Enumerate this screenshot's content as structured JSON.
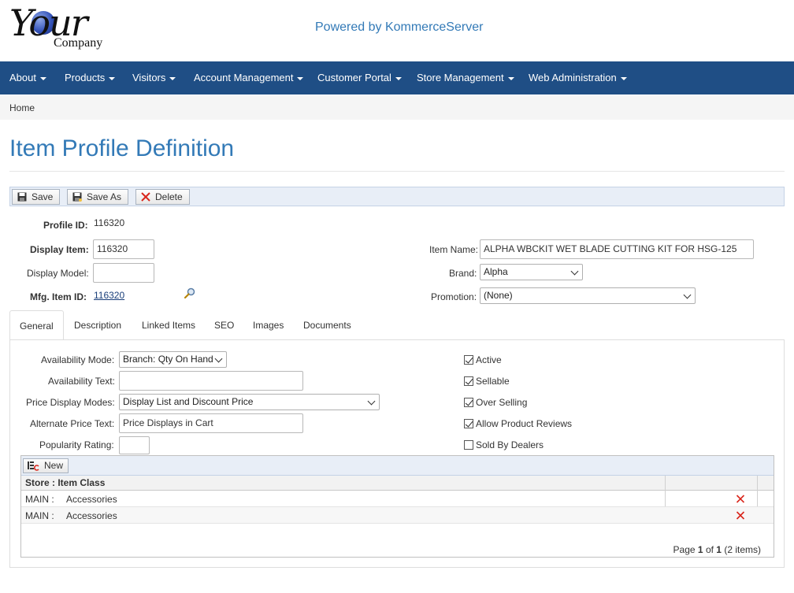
{
  "header": {
    "logo_text": "Your",
    "logo_sub": "Company",
    "powered_by": "Powered by KommerceServer"
  },
  "nav": {
    "items": [
      {
        "label": "About"
      },
      {
        "label": "Products"
      },
      {
        "label": "Visitors"
      },
      {
        "label": "Account Management"
      },
      {
        "label": "Customer Portal"
      },
      {
        "label": "Store Management"
      },
      {
        "label": "Web Administration"
      }
    ]
  },
  "breadcrumb": {
    "home": "Home"
  },
  "page": {
    "title": "Item Profile Definition"
  },
  "toolbar": {
    "save": "Save",
    "save_as": "Save As",
    "delete": "Delete"
  },
  "profile": {
    "profile_id_label": "Profile ID:",
    "profile_id": "116320",
    "display_item_label": "Display Item:",
    "display_item": "116320",
    "display_model_label": "Display Model:",
    "display_model": "",
    "mfg_item_id_label": "Mfg. Item ID:",
    "mfg_item_id": "116320",
    "item_name_label": "Item Name:",
    "item_name": "ALPHA WBCKIT WET BLADE CUTTING KIT FOR HSG-125",
    "brand_label": "Brand:",
    "brand": "Alpha",
    "promotion_label": "Promotion:",
    "promotion": "(None)"
  },
  "tabs": [
    {
      "label": "General"
    },
    {
      "label": "Description"
    },
    {
      "label": "Linked Items"
    },
    {
      "label": "SEO"
    },
    {
      "label": "Images"
    },
    {
      "label": "Documents"
    }
  ],
  "general": {
    "availability_mode_label": "Availability Mode:",
    "availability_mode": "Branch: Qty On Hand",
    "availability_text_label": "Availability Text:",
    "availability_text": "",
    "price_display_modes_label": "Price Display Modes:",
    "price_display_modes": "Display List and Discount Price",
    "alternate_price_text_label": "Alternate Price Text:",
    "alternate_price_text": "Price Displays in Cart",
    "popularity_rating_label": "Popularity Rating:",
    "popularity_rating": "",
    "checkboxes": [
      {
        "label": "Active",
        "checked": true
      },
      {
        "label": "Sellable",
        "checked": true
      },
      {
        "label": "Over Selling",
        "checked": true
      },
      {
        "label": "Allow Product Reviews",
        "checked": true
      },
      {
        "label": "Sold By Dealers",
        "checked": false
      }
    ]
  },
  "grid": {
    "new_label": "New",
    "header": "Store : Item Class",
    "rows": [
      {
        "store": "MAIN :",
        "item_class": "Accessories"
      },
      {
        "store": "MAIN :",
        "item_class": "Accessories"
      }
    ],
    "pager": {
      "prefix": "Page",
      "page": "1",
      "of": "of",
      "total": "1",
      "items": "(2 items)"
    }
  },
  "colors": {
    "nav_bg": "#1f4e85",
    "link": "#337ab7",
    "delete_red": "#d9261c"
  }
}
